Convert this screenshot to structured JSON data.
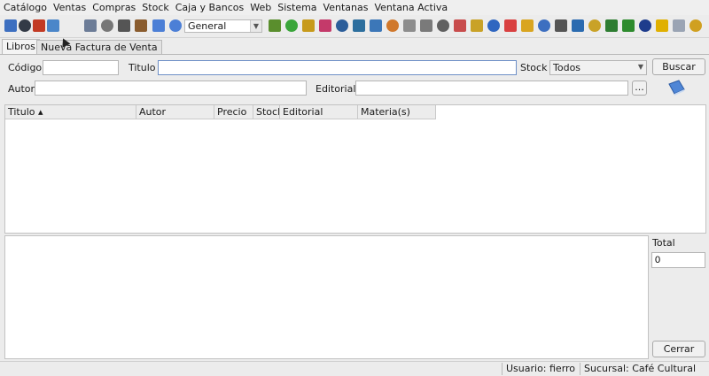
{
  "menu": [
    "Catálogo",
    "Ventas",
    "Compras",
    "Stock",
    "Caja y Bancos",
    "Web",
    "Sistema",
    "Ventanas",
    "Ventana Activa"
  ],
  "toolbar": {
    "period_value": "General",
    "icons": [
      {
        "name": "globe-icon",
        "color": "#3d6fc0"
      },
      {
        "name": "card-icon",
        "color": "#333a46"
      },
      {
        "name": "car-icon",
        "color": "#c23a24"
      },
      {
        "name": "fc-icon",
        "color": "#4b86c9"
      },
      {
        "name": "document-icon",
        "color": "#6c7c97"
      },
      {
        "name": "trash-icon",
        "color": "#777777"
      },
      {
        "name": "basket-icon",
        "color": "#555555"
      },
      {
        "name": "book-icon",
        "color": "#8a5c2e"
      },
      {
        "name": "window-blue-icon",
        "color": "#4c7fd6"
      },
      {
        "name": "window-blue2-icon",
        "color": "#4c7fd6"
      }
    ],
    "icons_right": [
      {
        "name": "link-icon",
        "color": "#5a8e2d"
      },
      {
        "name": "green-circle-icon",
        "color": "#3aa53a"
      },
      {
        "name": "key-icon",
        "color": "#c79a1b"
      },
      {
        "name": "pencil-icon",
        "color": "#c43a6a"
      },
      {
        "name": "ledger-icon",
        "color": "#2c5e9a"
      },
      {
        "name": "notebook-icon",
        "color": "#2d6f9e"
      },
      {
        "name": "grid-icon",
        "color": "#3c77b8"
      },
      {
        "name": "stack-icon",
        "color": "#d0782c"
      },
      {
        "name": "file-icon",
        "color": "#8d8d8d"
      },
      {
        "name": "box-icon",
        "color": "#7a7a7a"
      },
      {
        "name": "archive-icon",
        "color": "#606060"
      },
      {
        "name": "bag-icon",
        "color": "#c84c4c"
      },
      {
        "name": "clipboard-icon",
        "color": "#c9a227"
      },
      {
        "name": "save-icon",
        "color": "#2f66c0"
      },
      {
        "name": "image-icon",
        "color": "#d94040"
      },
      {
        "name": "coin-icon",
        "color": "#d9a520"
      },
      {
        "name": "doc-blue-icon",
        "color": "#3d6fc0"
      },
      {
        "name": "tool-icon",
        "color": "#555555"
      },
      {
        "name": "chart-icon",
        "color": "#2b6bb0"
      },
      {
        "name": "flag-icon",
        "color": "#c9a227"
      },
      {
        "name": "cards-icon",
        "color": "#2e7d32"
      },
      {
        "name": "dollar-icon",
        "color": "#2e8b2e"
      },
      {
        "name": "monitor-icon",
        "color": "#1e3c8c"
      },
      {
        "name": "bell-icon",
        "color": "#e0b000"
      },
      {
        "name": "window-icon",
        "color": "#9aa4b4"
      },
      {
        "name": "brush-icon",
        "color": "#d0a020"
      }
    ]
  },
  "tabs": [
    {
      "label": "Libros",
      "active": true
    },
    {
      "label": "Nueva Factura de Venta",
      "active": false
    }
  ],
  "form": {
    "codigo_label": "Código",
    "codigo_value": "",
    "titulo_label": "Titulo",
    "titulo_value": "",
    "stock_label": "Stock",
    "stock_value": "Todos",
    "search_button": "Buscar",
    "autor_label": "Autor",
    "autor_value": "",
    "editorial_label": "Editorial",
    "editorial_value": "",
    "browse_button": "..."
  },
  "table": {
    "columns": [
      "Titulo ▴",
      "Autor",
      "Precio",
      "Stock",
      "Editorial",
      "Materia(s)"
    ]
  },
  "total": {
    "label": "Total",
    "value": "0"
  },
  "close_button": "Cerrar",
  "status": {
    "user": "Usuario: fierro",
    "branch": "Sucursal: Café Cultural"
  }
}
